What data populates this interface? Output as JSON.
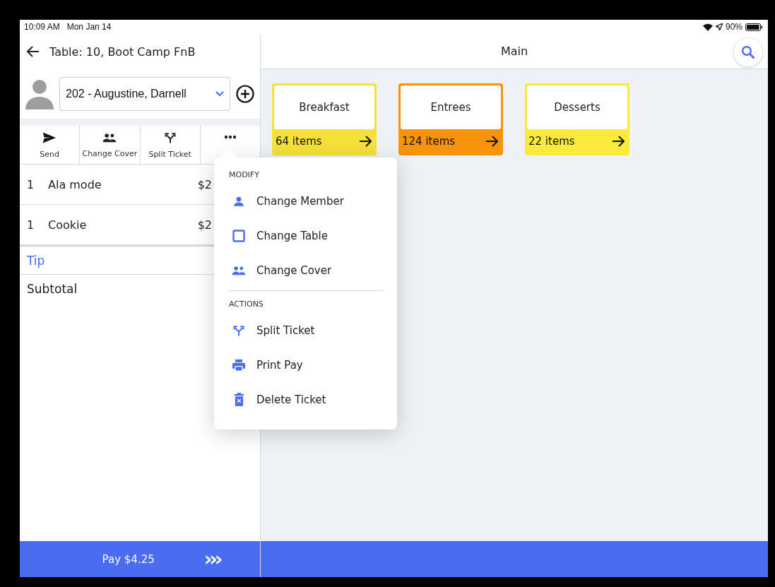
{
  "status_bar": {
    "time": "10:09 AM",
    "date": "Mon Jan 14",
    "battery": "90%"
  },
  "ticket": {
    "title": "Table: 10, Boot Camp FnB",
    "member": {
      "value": "202 - Augustine, Darnell"
    },
    "toolbar": [
      {
        "label": "Send"
      },
      {
        "label": "Change Cover"
      },
      {
        "label": "Split Ticket"
      }
    ],
    "items": [
      {
        "qty": "1",
        "name": "Ala mode",
        "price": "$2"
      },
      {
        "qty": "1",
        "name": "Cookie",
        "price": "$2"
      }
    ],
    "tip": "Tip",
    "subtotal": "Subtotal",
    "pay": "Pay $4.25",
    "pay_arrows": "›››"
  },
  "main": {
    "title": "Main",
    "categories": [
      {
        "name": "Breakfast",
        "count": "64 items",
        "color": "#f5e13a"
      },
      {
        "name": "Entrees",
        "count": "124 items",
        "color": "#f7940c"
      },
      {
        "name": "Desserts",
        "count": "22 items",
        "color": "#fbe93c"
      }
    ]
  },
  "menu": {
    "sections": [
      {
        "heading": "MODIFY",
        "items": [
          {
            "label": "Change Member"
          },
          {
            "label": "Change Table"
          },
          {
            "label": "Change Cover"
          }
        ]
      },
      {
        "heading": "ACTIONS",
        "items": [
          {
            "label": "Split Ticket"
          },
          {
            "label": "Print Pay"
          },
          {
            "label": "Delete Ticket"
          }
        ]
      }
    ]
  }
}
